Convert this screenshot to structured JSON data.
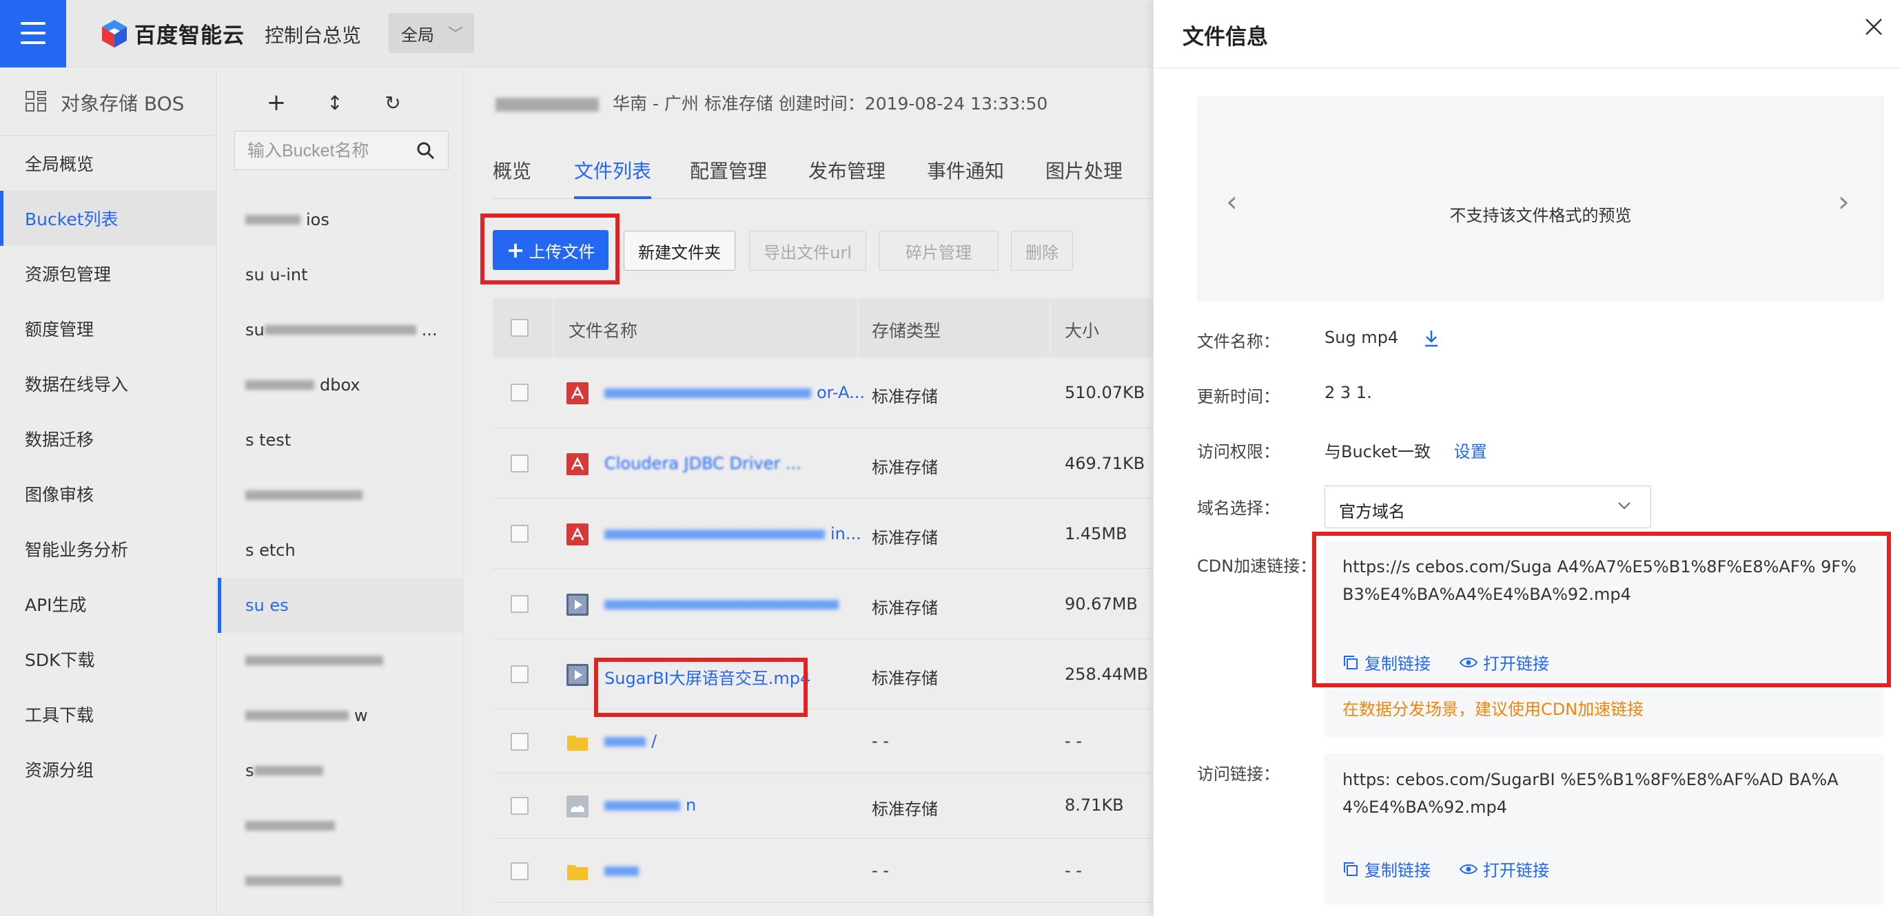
{
  "topbar": {
    "brand": "百度智能云",
    "console": "控制台总览",
    "region": "全局"
  },
  "nav": {
    "header": "对象存储 BOS",
    "items": [
      "全局概览",
      "Bucket列表",
      "资源包管理",
      "额度管理",
      "数据在线导入",
      "数据迁移",
      "图像审核",
      "智能业务分析",
      "API生成",
      "SDK下载",
      "工具下载",
      "资源分组"
    ],
    "active_index": 1
  },
  "bucketcol": {
    "search_placeholder": "输入Bucket名称",
    "items": [
      "ios",
      "su u-int",
      "su ",
      "dbox",
      "s test",
      "",
      "s etch",
      "su es",
      "",
      "w",
      "s",
      "",
      ""
    ]
  },
  "main": {
    "meta": "华南 - 广州   标准存储   创建时间：2019-08-24 13:33:50",
    "tabs": [
      "概览",
      "文件列表",
      "配置管理",
      "发布管理",
      "事件通知",
      "图片处理"
    ],
    "active_tab": 1,
    "buttons": {
      "upload": "上传文件",
      "newfolder": "新建文件夹",
      "exporturl": "导出文件url",
      "fragment": "碎片管理",
      "delete": "删除"
    },
    "table": {
      "headers": [
        "文件名称",
        "存储类型",
        "大小"
      ],
      "rows": [
        {
          "icon": "pdf-icon",
          "name": "or-A...",
          "type": "标准存储",
          "size": "510.07KB"
        },
        {
          "icon": "pdf-icon",
          "name": "Cloudera JDBC Driver ...",
          "type": "标准存储",
          "size": "469.71KB"
        },
        {
          "icon": "pdf-icon",
          "name": "in...",
          "type": "标准存储",
          "size": "1.45MB"
        },
        {
          "icon": "video-icon",
          "name": "",
          "type": "标准存储",
          "size": "90.67MB"
        },
        {
          "icon": "video-icon",
          "name": "SugarBI大屏语音交互.mp4",
          "type": "标准存储",
          "size": "258.44MB"
        },
        {
          "icon": "folder-icon",
          "name": "/",
          "type": "- -",
          "size": "- -"
        },
        {
          "icon": "image-icon",
          "name": "n",
          "type": "标准存储",
          "size": "8.71KB"
        },
        {
          "icon": "folder-icon",
          "name": "",
          "type": "- -",
          "size": "- -"
        }
      ]
    }
  },
  "panel": {
    "title": "文件信息",
    "preview_msg": "不支持该文件格式的预览",
    "labels": {
      "filename": "文件名称：",
      "updated": "更新时间：",
      "access": "访问权限：",
      "domain": "域名选择：",
      "cdn": "CDN加速链接：",
      "url": "访问链接："
    },
    "values": {
      "filename": "Sug mp4",
      "updated": "2 3 1.",
      "access": "与Bucket一致",
      "access_link": "设置",
      "domain": "官方域名"
    },
    "cdn": {
      "link": "https://s cebos.com/Suga A4%A7%E5%B1%8F%E8%AF% 9F%B3%E4%BA%A4%E4%BA%92.mp4",
      "copy": "复制链接",
      "open": "打开链接",
      "tip": "在数据分发场景，建议使用CDN加速链接"
    },
    "url": {
      "link": "https: cebos.com/SugarBI %E5%B1%8F%E8%AF%AD BA%A4%E4%BA%92.mp4",
      "copy": "复制链接",
      "open": "打开链接"
    }
  },
  "colors": {
    "accent": "#2468f2",
    "highlight_box": "#e02424",
    "tip": "#f0860a",
    "pdf": "#d43a3a"
  }
}
